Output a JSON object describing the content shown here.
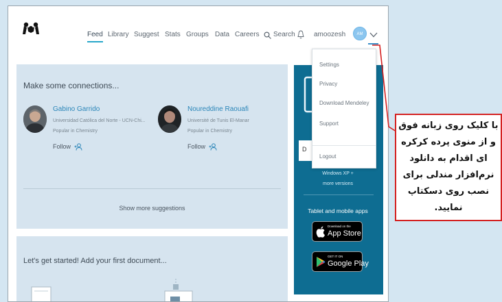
{
  "nav": {
    "items": [
      "Feed",
      "Library",
      "Suggest",
      "Stats",
      "Groups",
      "Data",
      "Careers"
    ],
    "search_label": "Search",
    "username": "amoozesh",
    "avatar_initials": "AM",
    "active_tab": "Feed"
  },
  "connections": {
    "title": "Make some connections...",
    "people": [
      {
        "name": "Gabino Garrido",
        "affiliation": "Universidad Católica del Norte - UCN-Chi...",
        "popularity": "Popular in Chemistry",
        "follow_label": "Follow"
      },
      {
        "name": "Noureddine Raouafi",
        "affiliation": "Université de Tunis El-Manar",
        "popularity": "Popular in Chemistry",
        "follow_label": "Follow"
      }
    ],
    "show_more_label": "Show more suggestions"
  },
  "get_started": {
    "title": "Let's get started! Add your first document..."
  },
  "desktop_panel": {
    "download_letter": "D",
    "windows_text": "Windows XP +",
    "more_versions": "more versions",
    "tablet_text": "Tablet and mobile apps",
    "app_store_small": "Download on the",
    "app_store_big": "App Store",
    "google_play_small": "GET IT ON",
    "google_play_big": "Google Play"
  },
  "dropdown": {
    "items": [
      "Settings",
      "Privacy",
      "Download Mendeley",
      "Support"
    ],
    "logout": "Logout"
  },
  "annotation": {
    "text": "با کلیک روی زبانه فوق و از منوی پرده کرکره ای اقدام به دانلود نرم‌افزار مندلی برای نصب روی دسکتاپ نمایید.",
    "border_color": "#d42020"
  },
  "icons": [
    "mendeley-logo-icon",
    "search-icon",
    "bell-icon",
    "chevron-down-icon",
    "add-person-icon",
    "apple-icon",
    "google-play-icon"
  ],
  "colors": {
    "accent": "#26a6c9",
    "panel": "#0e6d92",
    "card": "#d6e4ef",
    "link": "#2a85b8",
    "background": "#d4e6f2"
  }
}
